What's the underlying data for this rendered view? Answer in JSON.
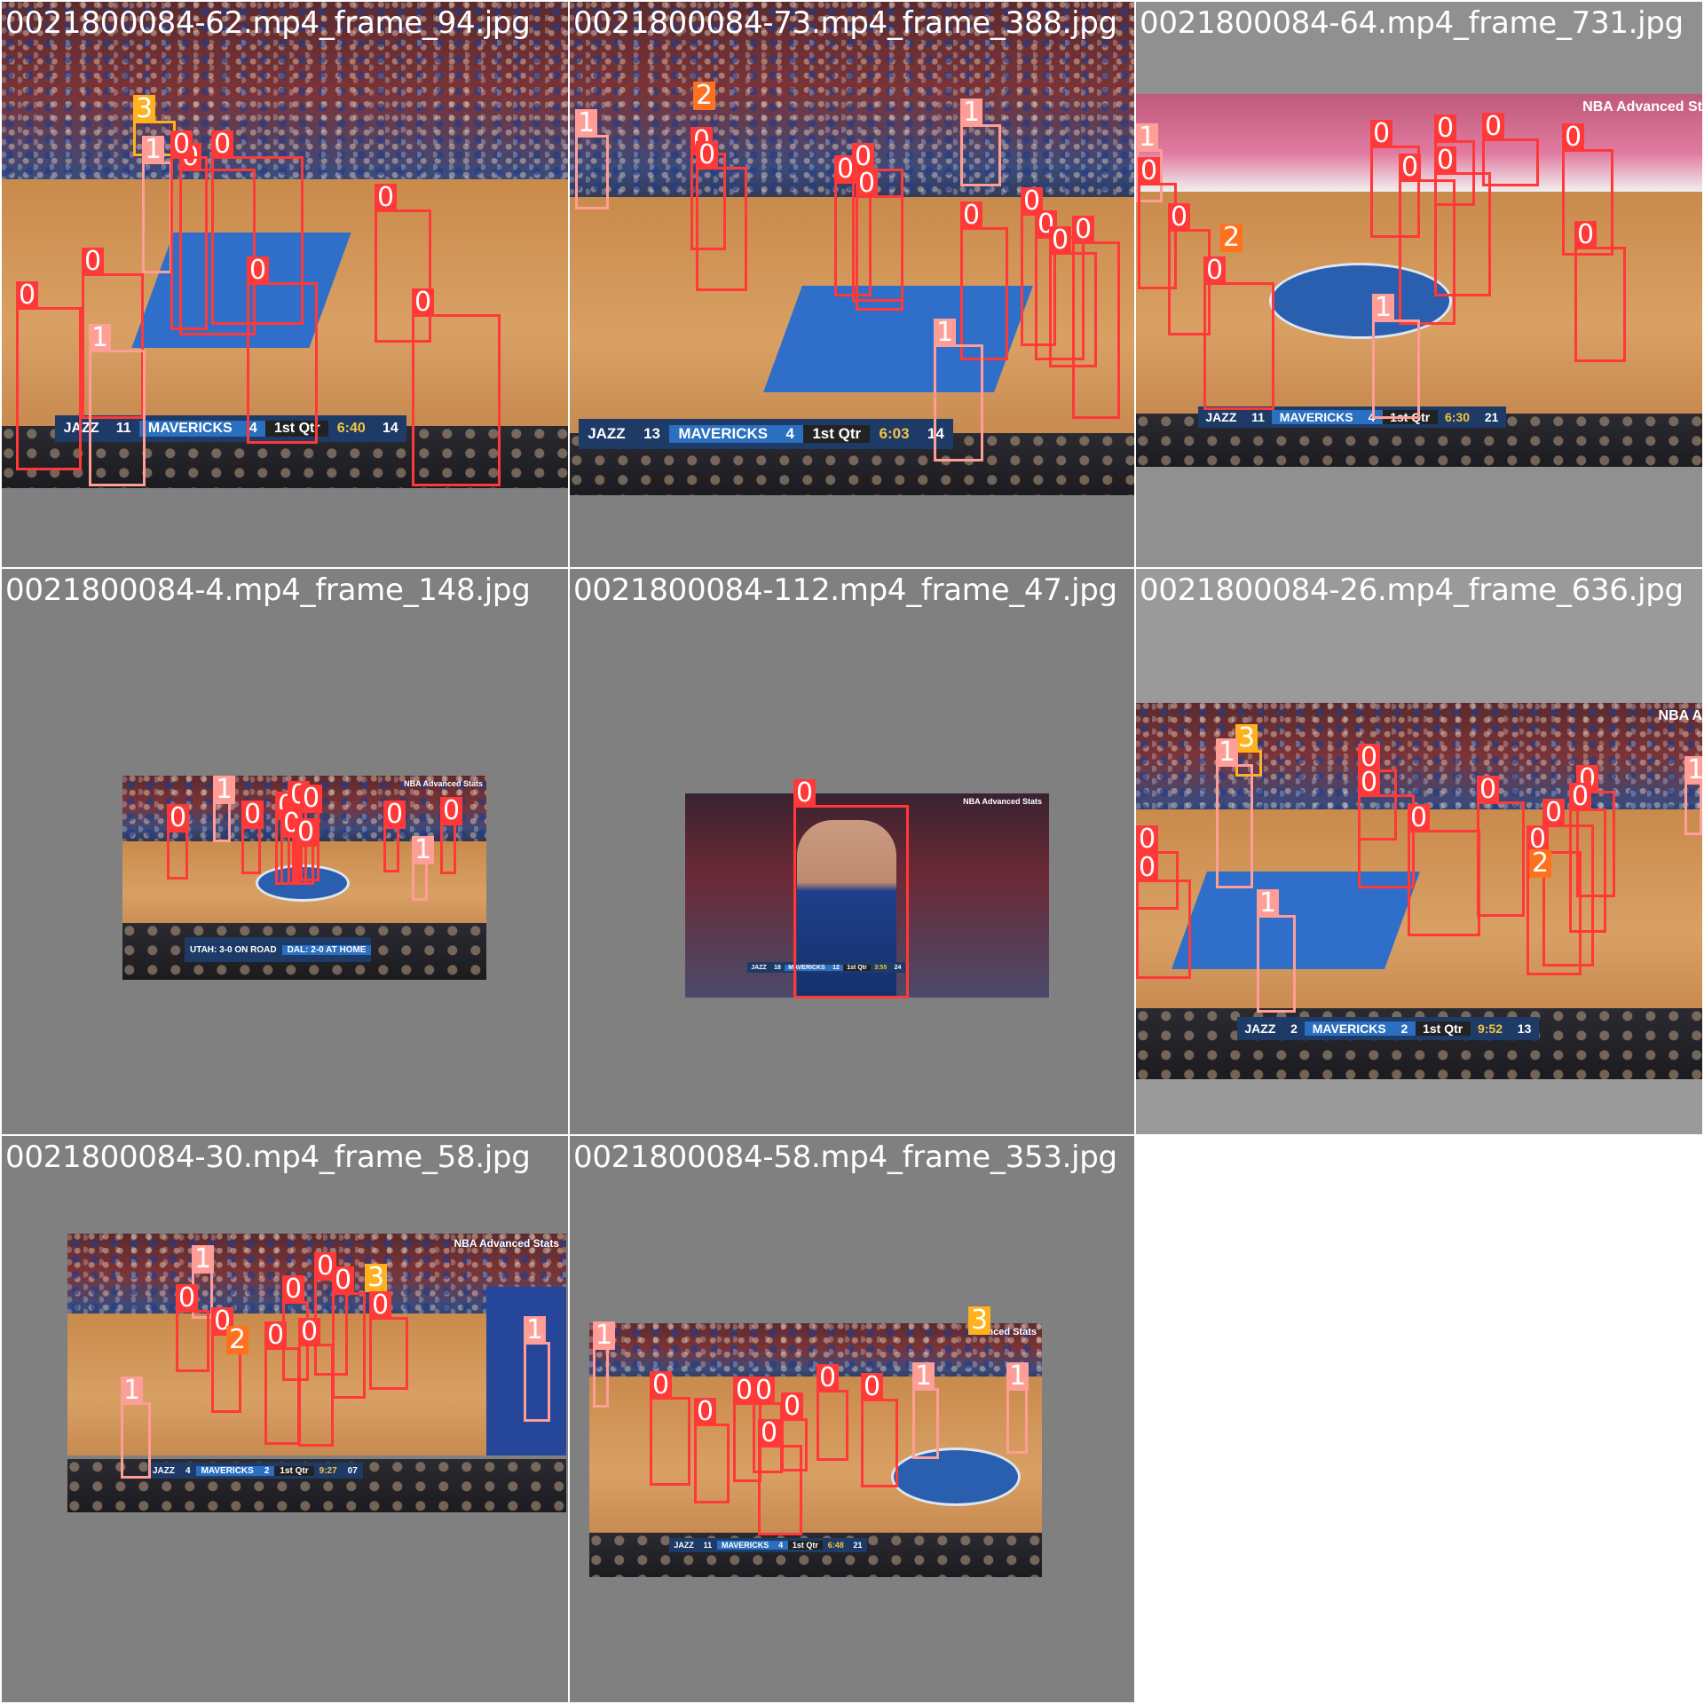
{
  "colors": {
    "class_0": "#ff3838",
    "class_1": "#ff9d97",
    "class_2": "#ff701f",
    "class_3": "#ffb21d",
    "tile_background": "#808080"
  },
  "tiles": [
    {
      "title": "0021800084-62.mp4_frame_94.jpg",
      "scorebug": {
        "team1": "JAZZ",
        "score1": "11",
        "team2": "MAVERICKS",
        "score2": "4",
        "quarter": "1st Qtr",
        "clock": "6:40",
        "shot_clock": "14"
      },
      "labels": [
        "3",
        "1",
        "0",
        "0",
        "0",
        "0",
        "0",
        "0",
        "1",
        "0",
        "0"
      ]
    },
    {
      "title": "0021800084-73.mp4_frame_388.jpg",
      "scorebug": {
        "team1": "JAZZ",
        "score1": "13",
        "team2": "MAVERICKS",
        "score2": "4",
        "quarter": "1st Qtr",
        "clock": "6:03",
        "shot_clock": "14"
      },
      "labels": [
        "1",
        "2",
        "0",
        "0",
        "1",
        "0",
        "0",
        "0",
        "0",
        "0",
        "0",
        "0",
        "0",
        "1"
      ]
    },
    {
      "title": "0021800084-64.mp4_frame_731.jpg",
      "watermark": "NBA Advanced St",
      "scorebug": {
        "team1": "JAZZ",
        "score1": "11",
        "team2": "MAVERICKS",
        "score2": "4",
        "quarter": "1st Qtr",
        "clock": "6:30",
        "shot_clock": "21"
      },
      "labels": [
        "1",
        "0",
        "0",
        "0",
        "2",
        "0",
        "0",
        "0",
        "0",
        "0",
        "0",
        "0",
        "1"
      ]
    },
    {
      "title": "0021800084-4.mp4_frame_148.jpg",
      "watermark": "NBA Advanced Stats",
      "banner": {
        "left": "UTAH: 3-0 ON ROAD",
        "right": "DAL: 2-0 AT HOME"
      },
      "labels": [
        "1",
        "0",
        "0",
        "0",
        "0",
        "0",
        "0",
        "0",
        "0",
        "1",
        "0"
      ]
    },
    {
      "title": "0021800084-112.mp4_frame_47.jpg",
      "watermark": "NBA Advanced Stats",
      "scorebug": {
        "team1": "JAZZ",
        "score1": "18",
        "team2": "MAVERICKS",
        "score2": "12",
        "quarter": "1st Qtr",
        "clock": "3:55",
        "shot_clock": "24"
      },
      "labels": [
        "0"
      ]
    },
    {
      "title": "0021800084-26.mp4_frame_636.jpg",
      "watermark": "NBA A",
      "scorebug": {
        "team1": "JAZZ",
        "score1": "2",
        "team2": "MAVERICKS",
        "score2": "2",
        "quarter": "1st Qtr",
        "clock": "9:52",
        "shot_clock": "13"
      },
      "labels": [
        "3",
        "1",
        "0",
        "0",
        "0",
        "0",
        "0",
        "0",
        "0",
        "0",
        "0",
        "0",
        "1",
        "2",
        "1"
      ]
    },
    {
      "title": "0021800084-30.mp4_frame_58.jpg",
      "watermark": "NBA Advanced Stats",
      "scorebug": {
        "team1": "JAZZ",
        "score1": "4",
        "team2": "MAVERICKS",
        "score2": "2",
        "quarter": "1st Qtr",
        "clock": "9:27",
        "shot_clock": "07"
      },
      "labels": [
        "1",
        "0",
        "0",
        "2",
        "0",
        "0",
        "0",
        "3",
        "0",
        "0",
        "0",
        "1",
        "1"
      ]
    },
    {
      "title": "0021800084-58.mp4_frame_353.jpg",
      "watermark": "vanced Stats",
      "scorebug": {
        "team1": "JAZZ",
        "score1": "11",
        "team2": "MAVERICKS",
        "score2": "4",
        "quarter": "1st Qtr",
        "clock": "6:48",
        "shot_clock": "21"
      },
      "labels": [
        "1",
        "3",
        "0",
        "0",
        "0",
        "0",
        "0",
        "0",
        "0",
        "1",
        "0",
        "1"
      ]
    }
  ]
}
